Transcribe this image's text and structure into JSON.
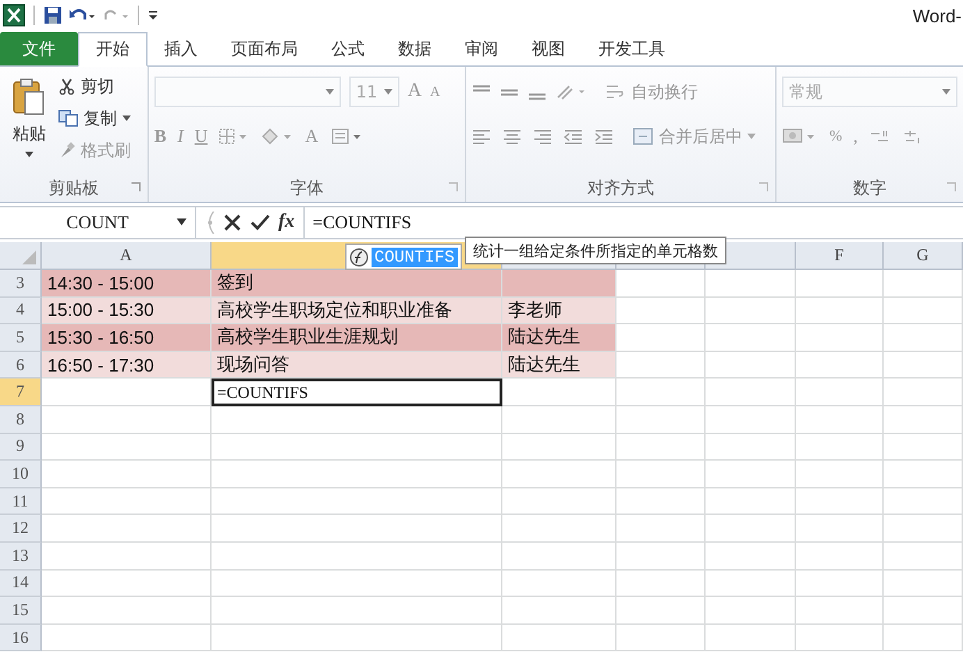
{
  "title_bar": {
    "title": "Word-"
  },
  "tabs": [
    {
      "label": "文件",
      "kind": "file",
      "selected": false
    },
    {
      "label": "开始",
      "kind": "tab",
      "selected": true
    },
    {
      "label": "插入",
      "kind": "tab",
      "selected": false
    },
    {
      "label": "页面布局",
      "kind": "tab",
      "selected": false
    },
    {
      "label": "公式",
      "kind": "tab",
      "selected": false
    },
    {
      "label": "数据",
      "kind": "tab",
      "selected": false
    },
    {
      "label": "审阅",
      "kind": "tab",
      "selected": false
    },
    {
      "label": "视图",
      "kind": "tab",
      "selected": false
    },
    {
      "label": "开发工具",
      "kind": "tab",
      "selected": false
    }
  ],
  "ribbon": {
    "clipboard": {
      "label": "剪贴板",
      "paste": {
        "label": "粘贴",
        "disabled": false
      },
      "cut": {
        "label": "剪切",
        "disabled": false
      },
      "copy": {
        "label": "复制",
        "disabled": false
      },
      "format_painter": {
        "label": "格式刷",
        "disabled": true
      }
    },
    "font": {
      "label": "字体",
      "disabled": true,
      "size": "11",
      "grow": "A",
      "shrink": "A",
      "bold": "B",
      "italic": "I",
      "underline": "U",
      "font_color": "A"
    },
    "alignment": {
      "label": "对齐方式",
      "disabled": true,
      "wrap_text": "自动换行",
      "merge_center": "合并后居中"
    },
    "number": {
      "label": "数字",
      "disabled": true,
      "format": "常规",
      "percent": "%",
      "comma": ","
    }
  },
  "formula_bar": {
    "name_box": "COUNT",
    "function_button": "fx",
    "formula": "=COUNTIFS"
  },
  "autocomplete": {
    "items": [
      {
        "label": "COUNTIFS",
        "selected": true
      }
    ],
    "tooltip": "统计一组给定条件所指定的单元格数"
  },
  "columns": [
    {
      "label": "A",
      "selected": false
    },
    {
      "selected": true
    },
    {
      "selected": false
    },
    {
      "selected": false
    },
    {
      "selected": false
    },
    {
      "label": "F",
      "selected": false
    },
    {
      "label": "G",
      "selected": false
    }
  ],
  "rows": [
    {
      "number": "3",
      "selected": false,
      "color": "#e6b8b7",
      "a": "14:30 - 15:00",
      "b": "签到"
    },
    {
      "number": "4",
      "selected": false,
      "color": "#f2dcdb",
      "a": "15:00 - 15:30",
      "b": "高校学生职场定位和职业准备",
      "c": "李老师"
    },
    {
      "number": "5",
      "selected": false,
      "color": "#e6b8b7",
      "a": "15:30 - 16:50",
      "b": "高校学生职业生涯规划",
      "c": "陆达先生"
    },
    {
      "number": "6",
      "selected": false,
      "color": "#f2dcdb",
      "a": "16:50 - 17:30",
      "b": "现场问答",
      "c": "陆达先生"
    },
    {
      "number": "7",
      "selected": true,
      "b": "=COUNTIFS"
    },
    {
      "number": "8",
      "selected": false
    },
    {
      "number": "9",
      "selected": false
    },
    {
      "number": "10",
      "selected": false
    },
    {
      "number": "11",
      "selected": false
    },
    {
      "number": "12",
      "selected": false
    },
    {
      "number": "13",
      "selected": false
    },
    {
      "number": "14",
      "selected": false
    },
    {
      "number": "15",
      "selected": false
    },
    {
      "number": "16",
      "selected": false
    }
  ]
}
